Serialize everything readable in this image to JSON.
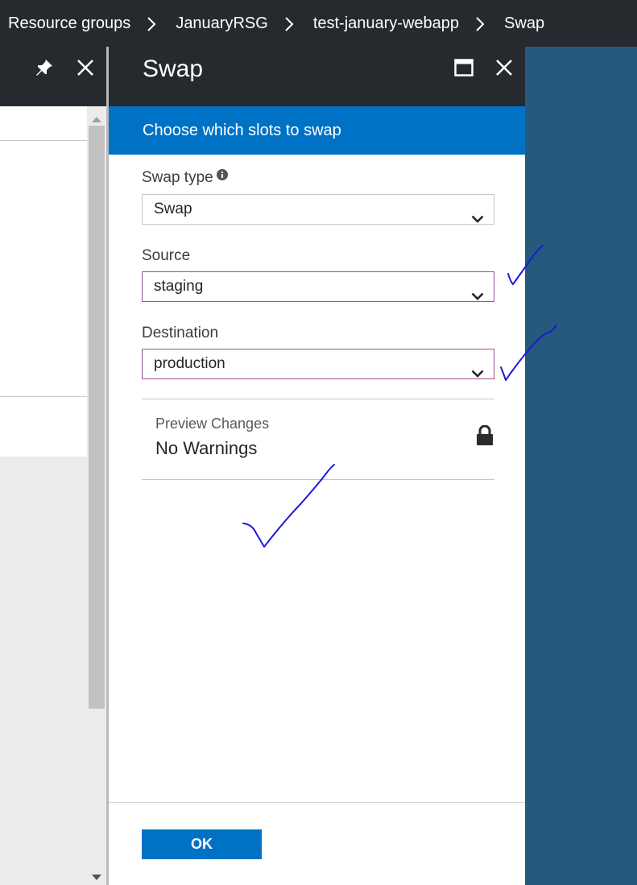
{
  "breadcrumb": {
    "items": [
      "Resource groups",
      "JanuaryRSG",
      "test-january-webapp",
      "Swap"
    ]
  },
  "swap_blade": {
    "title": "Swap",
    "banner": "Choose which slots to swap",
    "swap_type": {
      "label": "Swap type",
      "value": "Swap"
    },
    "source": {
      "label": "Source",
      "value": "staging"
    },
    "destination": {
      "label": "Destination",
      "value": "production"
    },
    "preview": {
      "title": "Preview Changes",
      "value": "No Warnings"
    },
    "ok_label": "OK"
  },
  "colors": {
    "chrome_dark": "#262a2f",
    "accent_blue": "#0072c6",
    "backdrop_blue": "#255a7d",
    "selected_border": "#9b4f96",
    "annotation_ink": "#1a1adb"
  },
  "icons": [
    "pin-icon",
    "close-icon",
    "maximize-icon",
    "info-icon",
    "chevron-down-icon",
    "lock-icon",
    "chevron-right-icon"
  ]
}
